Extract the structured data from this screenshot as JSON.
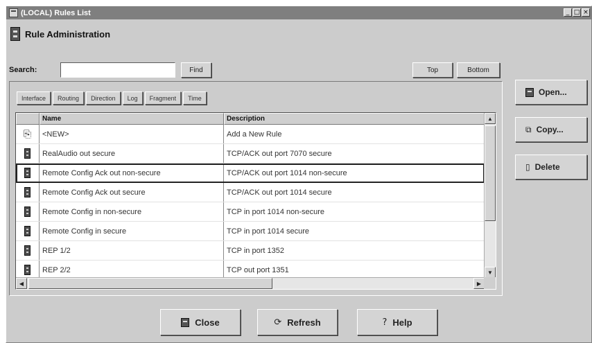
{
  "window": {
    "title": "(LOCAL) Rules List",
    "buttons": {
      "minimize": "_",
      "maximize": "□",
      "close": "×"
    }
  },
  "header": {
    "title": "Rule Administration"
  },
  "search": {
    "label": "Search:",
    "value": "",
    "find_label": "Find",
    "top_label": "Top",
    "bottom_label": "Bottom"
  },
  "tabs": [
    "Interface",
    "Routing",
    "Direction",
    "Log",
    "Fragment",
    "Time"
  ],
  "table": {
    "columns": [
      "Name",
      "Description"
    ],
    "rows": [
      {
        "icon": "new-rule-icon",
        "name": "<NEW>",
        "desc": "Add a New Rule"
      },
      {
        "icon": "rule-icon",
        "name": "RealAudio out secure",
        "desc": "TCP/ACK out port 7070 secure"
      },
      {
        "icon": "rule-icon",
        "name": "Remote Config Ack out non-secure",
        "desc": "TCP/ACK out port 1014 non-secure",
        "selected": true
      },
      {
        "icon": "rule-icon",
        "name": "Remote Config Ack out secure",
        "desc": "TCP/ACK out port 1014 secure"
      },
      {
        "icon": "rule-icon",
        "name": "Remote Config in non-secure",
        "desc": "TCP in port 1014 non-secure"
      },
      {
        "icon": "rule-icon",
        "name": "Remote Config in secure",
        "desc": "TCP in port 1014 secure"
      },
      {
        "icon": "rule-icon",
        "name": "REP 1/2",
        "desc": "TCP in port 1352"
      },
      {
        "icon": "rule-icon",
        "name": "REP 2/2",
        "desc": "TCP out port 1351"
      }
    ]
  },
  "side_buttons": {
    "open": "Open...",
    "copy": "Copy...",
    "delete": "Delete"
  },
  "bottom_buttons": {
    "close": "Close",
    "refresh": "Refresh",
    "help": "Help"
  },
  "icons": {
    "open": "folder-icon",
    "copy": "copy-icon",
    "delete": "delete-icon",
    "close": "close-icon",
    "refresh": "refresh-icon",
    "help": "help-icon"
  }
}
